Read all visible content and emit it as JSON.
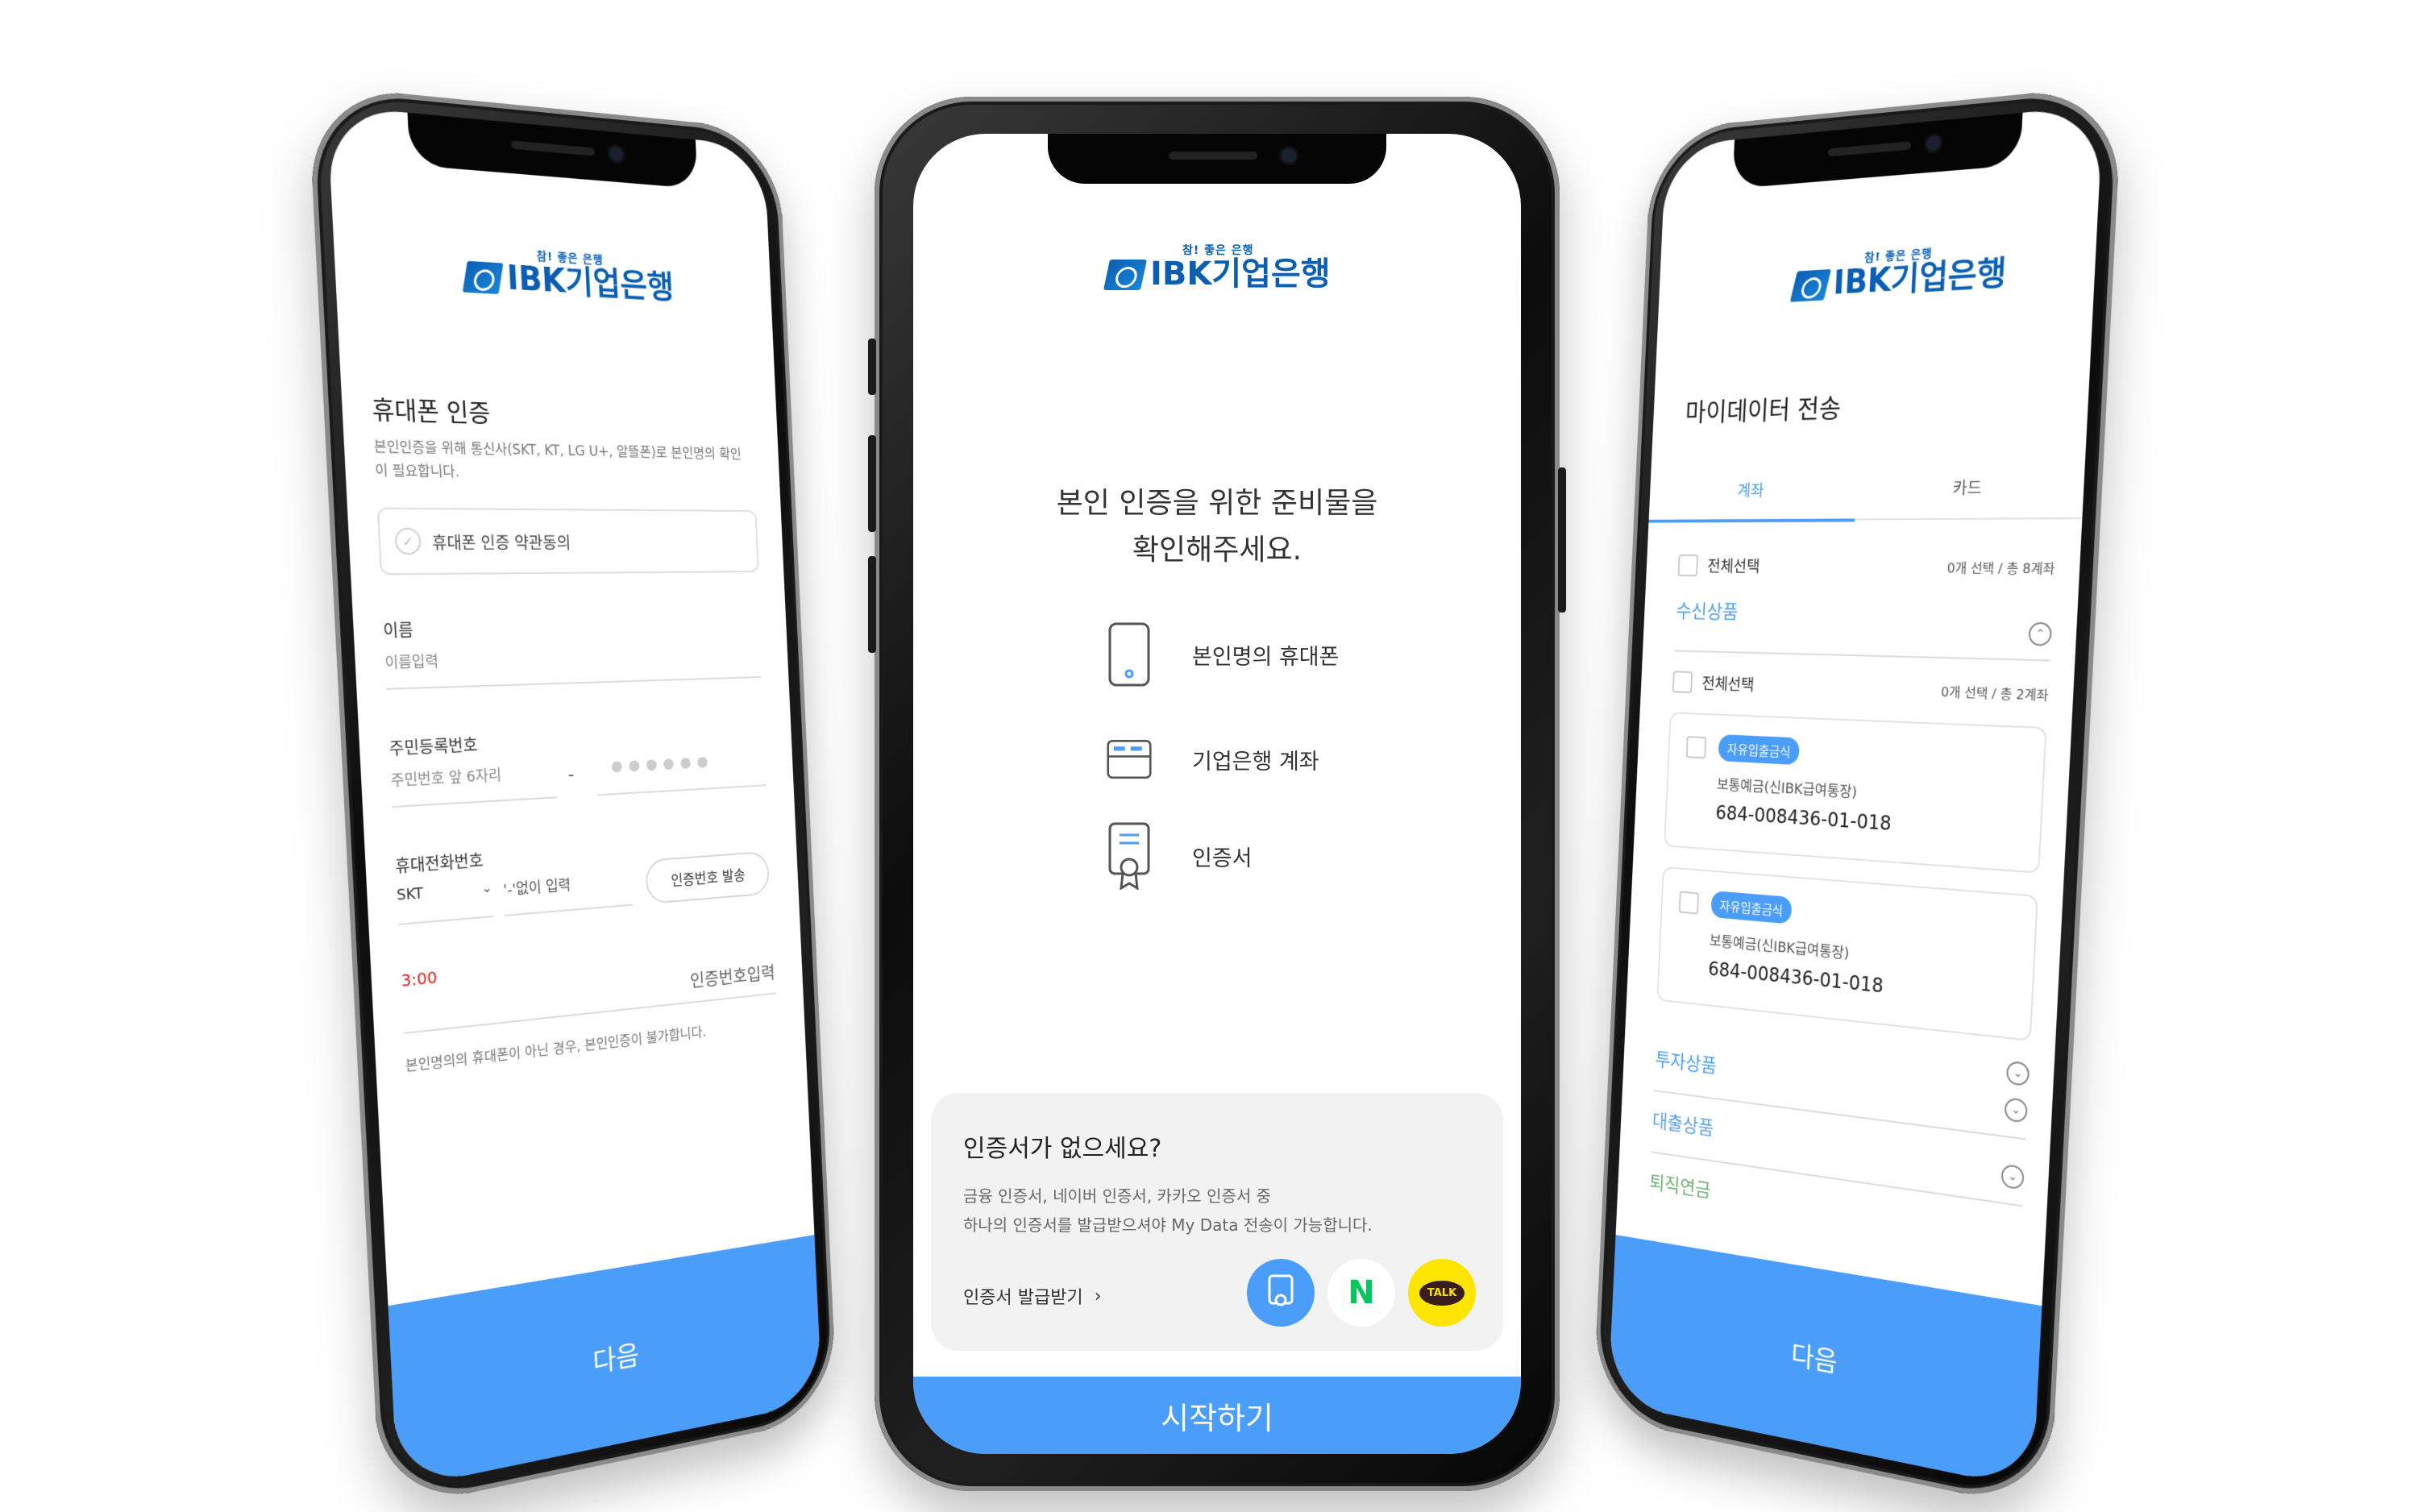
{
  "brand": {
    "slogan": "참! 좋은 은행",
    "name": "IBK기업은행"
  },
  "left_phone": {
    "title": "휴대폰 인증",
    "description": "본인인증을 위해 통신사(SKT, KT, LG U+, 알뜰폰)로 본인명의 확인이 필요합니다.",
    "agree_label": "휴대폰 인증 약관동의",
    "name_label": "이름",
    "name_placeholder": "이름입력",
    "rrn_label": "주민등록번호",
    "rrn_placeholder": "주민번호 앞 6자리",
    "rrn_dash": "-",
    "rrn_masked": "●●●●●●",
    "phone_label": "휴대전화번호",
    "carrier": "SKT",
    "phone_placeholder": "'-'없이 입력",
    "send_button": "인증번호 발송",
    "timer": "3:00",
    "code_placeholder": "인증번호입력",
    "notice": "본인명의의 휴대폰이 아닌 경우, 본인인증이 불가합니다.",
    "next_button": "다음"
  },
  "center_phone": {
    "title_line1": "본인 인증을 위한 준비물을",
    "title_line2": "확인해주세요.",
    "items": [
      {
        "icon": "smartphone-icon",
        "label": "본인명의 휴대폰"
      },
      {
        "icon": "bankbook-icon",
        "label": "기업은행 계좌"
      },
      {
        "icon": "certificate-icon",
        "label": "인증서"
      }
    ],
    "nocert": {
      "title": "인증서가 없으세요?",
      "desc_line1": "금융 인증서, 네이버 인증서, 카카오 인증서 중",
      "desc_line2": "하나의 인증서를 발급받으셔야 My Data 전송이 가능합니다.",
      "issue_link": "인증서 발급받기",
      "naver_letter": "N",
      "kakao_text": "TALK"
    },
    "start_button": "시작하기"
  },
  "right_phone": {
    "title": "마이데이터 전송",
    "tabs": [
      "계좌",
      "카드"
    ],
    "select_all_1": "전체선택",
    "count_1": "0개 선택 / 총 8계좌",
    "category_deposit": "수신상품",
    "select_all_2": "전체선택",
    "count_2": "0개 선택 / 총 2계좌",
    "accounts": [
      {
        "badge": "자유입출금식",
        "name": "보통예금(신IBK급여통장)",
        "number": "684-008436-01-018"
      },
      {
        "badge": "자유입출금식",
        "name": "보통예금(신IBK급여통장)",
        "number": "684-008436-01-018"
      }
    ],
    "category_invest": "투자상품",
    "category_loan": "대출상품",
    "category_pension": "퇴직연금",
    "next_button": "다음"
  },
  "colors": {
    "primary": "#4a9df8",
    "brand": "#0a5fb4",
    "timer": "#e02020",
    "naver": "#03c75a",
    "kakao": "#fee500"
  }
}
